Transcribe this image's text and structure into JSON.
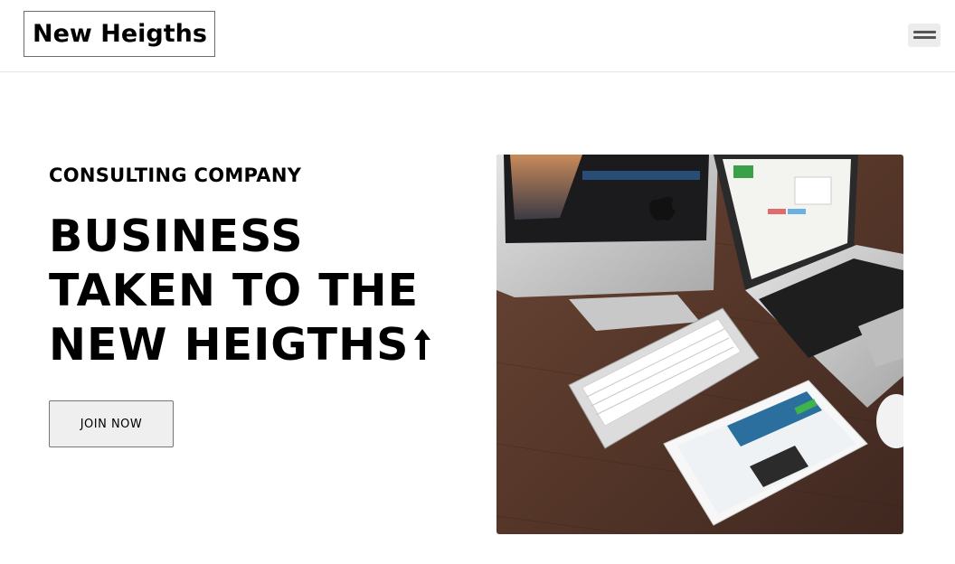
{
  "header": {
    "brand": "New Heigths",
    "menu_icon": "hamburger-menu-icon"
  },
  "hero": {
    "eyebrow": "CONSULTING COMPANY",
    "headline_lines": [
      "BUSINESS",
      "TAKEN TO THE",
      "NEW HEIGTHS"
    ],
    "headline_icon": "arrow-up-icon",
    "cta_label": "JOIN NOW",
    "image_subject": "desk with iMac, keyboard, MacBook and iPad"
  },
  "colors": {
    "text": "#000000",
    "button_bg": "#efefef",
    "border": "#767676",
    "desk_wood": "#5a3b2c"
  }
}
